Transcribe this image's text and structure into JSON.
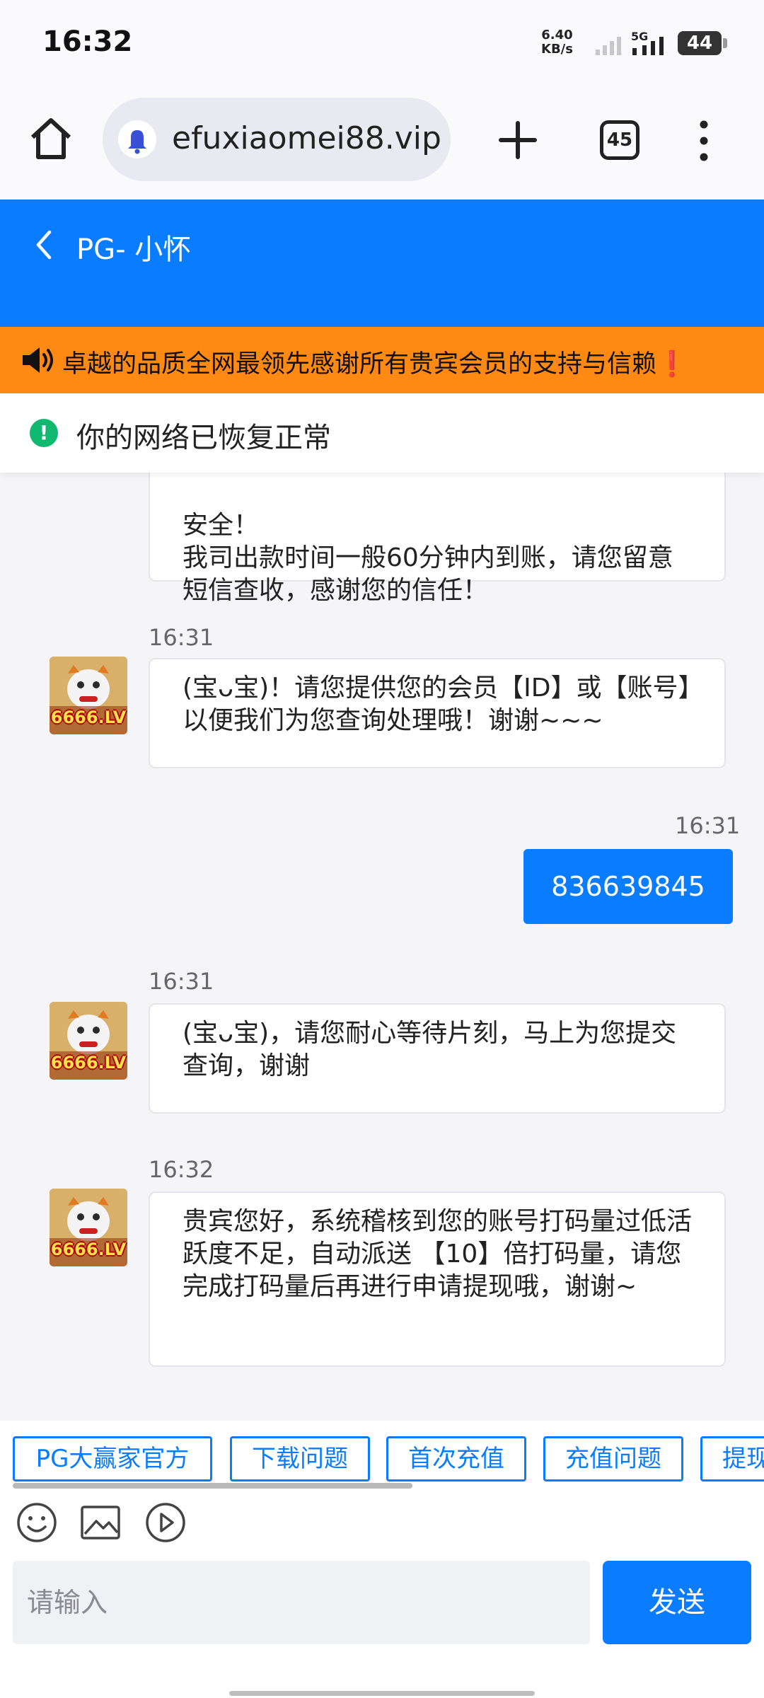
{
  "status_bar": {
    "time": "16:32",
    "net_speed_value": "6.40",
    "net_speed_unit": "KB/s",
    "network_type": "5G",
    "battery": "44"
  },
  "browser": {
    "url": "efuxiaomei88.vip",
    "tab_count": "45"
  },
  "chat": {
    "title": "PG- 小怀",
    "notice": "卓越的品质全网最领先感谢所有贵宾会员的支持与信赖",
    "notice_mark": "❗",
    "network_status": "你的网络已恢复正常",
    "messages": [
      {
        "type": "incoming",
        "text": "安全！\n我司出款时间一般60分钟内到账，请您留意短信查收，感谢您的信任！"
      },
      {
        "type": "incoming",
        "time": "16:31",
        "avatar_label": "6666.LV",
        "text": "(宝ᴗ宝)！请您提供您的会员【ID】或【账号】以便我们为您查询处理哦！谢谢~~~"
      },
      {
        "type": "outgoing",
        "time": "16:31",
        "text": "836639845"
      },
      {
        "type": "incoming",
        "time": "16:31",
        "avatar_label": "6666.LV",
        "text": "(宝ᴗ宝)，请您耐心等待片刻，马上为您提交查询，谢谢"
      },
      {
        "type": "incoming",
        "time": "16:32",
        "avatar_label": "6666.LV",
        "text": "贵宾您好，系统稽核到您的账号打码量过低活跃度不足，自动派送 【10】倍打码量，请您完成打码量后再进行申请提现哦，谢谢~"
      }
    ]
  },
  "quick_replies": [
    "PG大赢家官方",
    "下载问题",
    "首次充值",
    "充值问题",
    "提现问题"
  ],
  "input": {
    "placeholder": "请输入",
    "send_label": "发送"
  },
  "colors": {
    "header_blue": "#0a7cff",
    "notice_orange": "#ff8a13",
    "success_green": "#11b86f"
  },
  "icons": [
    "home-icon",
    "bell-icon",
    "plus-icon",
    "more-vert-icon",
    "back-arrow-icon",
    "speaker-icon",
    "check-circle-icon",
    "emoji-icon",
    "image-icon",
    "video-icon"
  ]
}
